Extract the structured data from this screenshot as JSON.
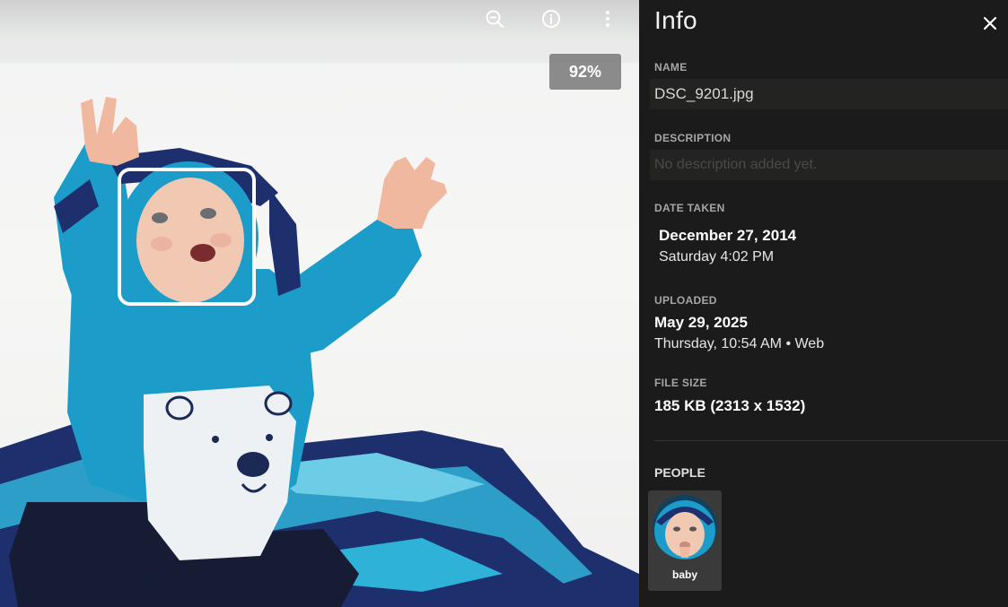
{
  "toolbar": {
    "zoom_out_icon": "zoom-out-icon",
    "info_icon": "info-icon",
    "more_icon": "more-vertical-icon"
  },
  "viewer": {
    "zoom_level": "92%"
  },
  "panel": {
    "title": "Info",
    "close_icon": "close-icon",
    "name_label": "NAME",
    "name_value": "DSC_9201.jpg",
    "description_label": "DESCRIPTION",
    "description_placeholder": "No description added yet.",
    "date_taken_label": "DATE TAKEN",
    "date_taken_date": "December 27, 2014",
    "date_taken_time": "Saturday 4:02 PM",
    "uploaded_label": "UPLOADED",
    "uploaded_date": "May 29, 2025",
    "uploaded_detail": "Thursday, 10:54 AM • Web",
    "file_size_label": "FILE SIZE",
    "file_size_value": "185 KB (2313 x 1532)",
    "people_label": "PEOPLE",
    "people": [
      {
        "name": "baby"
      }
    ]
  },
  "colors": {
    "panel_bg": "#1c1b1c",
    "hoodie": "#1b9cc9",
    "blanket_dark": "#1e2f6e",
    "blanket_light": "#2fb2d8"
  }
}
